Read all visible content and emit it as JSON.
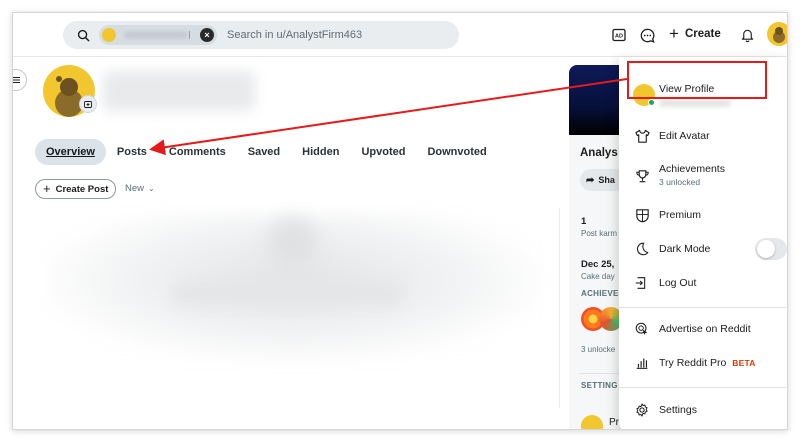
{
  "header": {
    "search_placeholder": "Search in u/AnalystFirm463",
    "create_label": "Create"
  },
  "profile": {
    "tabs": [
      {
        "label": "Overview",
        "active": true
      },
      {
        "label": "Posts"
      },
      {
        "label": "Comments"
      },
      {
        "label": "Saved"
      },
      {
        "label": "Hidden"
      },
      {
        "label": "Upvoted"
      },
      {
        "label": "Downvoted"
      }
    ],
    "create_post_label": "Create Post",
    "sort_label": "New"
  },
  "sidebar": {
    "title": "Analys",
    "share_label": "Sha",
    "post_karma_value": "1",
    "post_karma_label": "Post karm",
    "cake_day_value": "Dec 25,",
    "cake_day_label": "Cake day",
    "achievements_heading": "ACHIEVE",
    "achievements_count": "3 unlocke",
    "settings_heading": "SETTING",
    "profile_label": "Pr"
  },
  "menu": {
    "view_profile": "View Profile",
    "edit_avatar": "Edit Avatar",
    "achievements": "Achievements",
    "achievements_sub": "3 unlocked",
    "premium": "Premium",
    "dark_mode": "Dark Mode",
    "dark_mode_on": false,
    "log_out": "Log Out",
    "advertise": "Advertise on Reddit",
    "try_pro": "Try Reddit Pro",
    "beta": "BETA",
    "settings": "Settings"
  },
  "colors": {
    "highlight": "#e51a1a",
    "avatar": "#f2c62f",
    "online": "#1aa85a",
    "beta": "#d93a00"
  }
}
